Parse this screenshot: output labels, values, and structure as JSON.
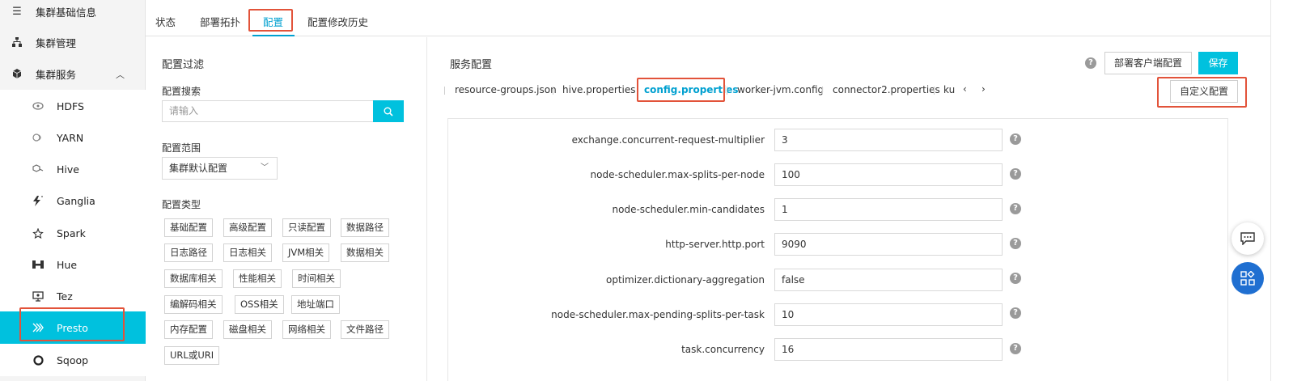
{
  "sidebar": {
    "items": [
      {
        "label": "集群基础信息",
        "icon": "list-icon"
      },
      {
        "label": "集群管理",
        "icon": "hierarchy-icon"
      },
      {
        "label": "集群服务",
        "icon": "cube-icon"
      },
      {
        "label": "HDFS",
        "icon": "hdfs-icon"
      },
      {
        "label": "YARN",
        "icon": "yarn-icon"
      },
      {
        "label": "Hive",
        "icon": "hive-icon"
      },
      {
        "label": "Ganglia",
        "icon": "ganglia-icon"
      },
      {
        "label": "Spark",
        "icon": "spark-icon"
      },
      {
        "label": "Hue",
        "icon": "hue-icon"
      },
      {
        "label": "Tez",
        "icon": "tez-icon"
      },
      {
        "label": "Presto",
        "icon": "presto-icon"
      },
      {
        "label": "Sqoop",
        "icon": "sqoop-icon"
      }
    ],
    "active": "Presto",
    "active_color": "#00c1de"
  },
  "tabs": [
    "状态",
    "部署拓扑",
    "配置",
    "配置修改历史"
  ],
  "active_tab": "配置",
  "filter": {
    "title": "配置过滤",
    "search_label": "配置搜索",
    "search_placeholder": "请输入",
    "scope_label": "配置范围",
    "scope_value": "集群默认配置",
    "type_label": "配置类型",
    "types": [
      "基础配置",
      "高级配置",
      "只读配置",
      "数据路径",
      "日志路径",
      "日志相关",
      "JVM相关",
      "数据相关",
      "数据库相关",
      "性能相关",
      "时间相关",
      "编解码相关",
      "OSS相关",
      "地址端口",
      "内存配置",
      "磁盘相关",
      "网络相关",
      "文件路径",
      "URL或URI"
    ]
  },
  "service_config": {
    "title": "服务配置",
    "deploy_client_button": "部署客户端配置",
    "save_button": "保存",
    "custom_config_button": "自定义配置",
    "file_tabs": [
      "resource-groups.json",
      "hive.properties",
      "config.properties",
      "worker-jvm.config",
      "connector2.properties",
      "ku"
    ],
    "active_file_tab": "config.properties",
    "properties": [
      {
        "key": "exchange.concurrent-request-multiplier",
        "value": "3"
      },
      {
        "key": "node-scheduler.max-splits-per-node",
        "value": "100"
      },
      {
        "key": "node-scheduler.min-candidates",
        "value": "1"
      },
      {
        "key": "http-server.http.port",
        "value": "9090"
      },
      {
        "key": "optimizer.dictionary-aggregation",
        "value": "false"
      },
      {
        "key": "node-scheduler.max-pending-splits-per-task",
        "value": "10"
      },
      {
        "key": "task.concurrency",
        "value": "16"
      }
    ]
  },
  "colors": {
    "accent": "#00c1de",
    "link": "#00a0d0",
    "highlight": "#e2533a",
    "float_button": "#1f6fd1"
  }
}
